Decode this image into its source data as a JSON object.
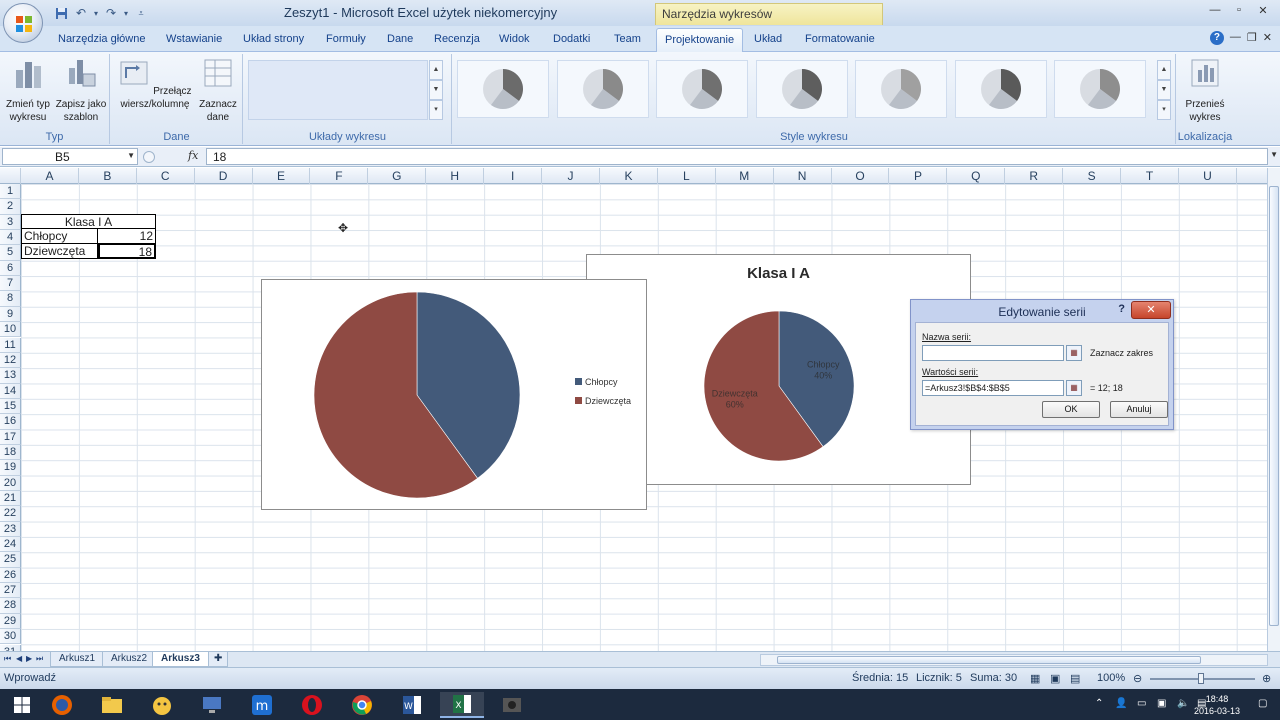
{
  "window": {
    "title": "Zeszyt1 - Microsoft Excel użytek niekomercyjny",
    "context_tab": "Narzędzia wykresów"
  },
  "ribbon": {
    "tabs": [
      "Narzędzia główne",
      "Wstawianie",
      "Układ strony",
      "Formuły",
      "Dane",
      "Recenzja",
      "Widok",
      "Dodatki",
      "Team",
      "Projektowanie",
      "Układ",
      "Formatowanie"
    ],
    "active_tab": "Projektowanie",
    "groups": {
      "typ": {
        "label": "Typ",
        "buttons": [
          "Zmień typ wykresu",
          "Zapisz jako szablon"
        ]
      },
      "dane": {
        "label": "Dane",
        "buttons": [
          "Przełącz wiersz/kolumnę",
          "Zaznacz dane"
        ]
      },
      "uklady": {
        "label": "Układy wykresu"
      },
      "style": {
        "label": "Style wykresu"
      },
      "lokalizacja": {
        "label": "Lokalizacja",
        "buttons": [
          "Przenieś wykres"
        ]
      }
    },
    "style_colors": [
      "#6b6b6b",
      "#8a8a8a",
      "#707070",
      "#5e5e5e",
      "#a0a0a0",
      "#5a5a5a",
      "#8e8e8e"
    ]
  },
  "formula_bar": {
    "name_box": "B5",
    "fx": "fx",
    "value": "18"
  },
  "grid": {
    "columns": [
      "A",
      "B",
      "C",
      "D",
      "E",
      "F",
      "G",
      "H",
      "I",
      "J",
      "K",
      "L",
      "M",
      "N",
      "O",
      "P",
      "Q",
      "R",
      "S",
      "T",
      "U"
    ],
    "rows": [
      "1",
      "2",
      "3",
      "4",
      "5",
      "6",
      "7",
      "8",
      "9",
      "10",
      "11",
      "12",
      "13",
      "14",
      "15",
      "16",
      "17",
      "18",
      "19",
      "20",
      "21",
      "22",
      "23",
      "24",
      "25",
      "26",
      "27",
      "28",
      "29",
      "30",
      "31"
    ],
    "table": {
      "header": "Klasa I A",
      "rows": [
        {
          "label": "Chłopcy",
          "value": "12"
        },
        {
          "label": "Dziewczęta",
          "value": "18"
        }
      ]
    }
  },
  "chart_data": [
    {
      "type": "pie",
      "categories": [
        "Chłopcy",
        "Dziewczęta"
      ],
      "values": [
        12,
        18
      ],
      "colors": [
        "#435a7a",
        "#8f4a43"
      ],
      "legend": "right"
    },
    {
      "type": "pie",
      "title": "Klasa I A",
      "categories": [
        "Chłopcy",
        "Dziewczęta"
      ],
      "values": [
        12,
        18
      ],
      "data_labels": [
        "40%",
        "60%"
      ],
      "colors": [
        "#435a7a",
        "#8f4a43"
      ]
    }
  ],
  "dialog": {
    "title": "Edytowanie serii",
    "help": "?",
    "close": "✕",
    "name_label": "Nazwa serii:",
    "name_value": "",
    "name_note": "Zaznacz zakres",
    "values_label": "Wartości serii:",
    "values_value": "=Arkusz3!$B$4:$B$5",
    "values_note": "= 12; 18",
    "ok": "OK",
    "cancel": "Anuluj"
  },
  "sheets": {
    "tabs": [
      "Arkusz1",
      "Arkusz2",
      "Arkusz3"
    ],
    "active": "Arkusz3"
  },
  "status": {
    "mode": "Wprowadź",
    "average": "Średnia: 15",
    "count": "Licznik: 5",
    "sum": "Suma: 30",
    "zoom": "100%"
  },
  "taskbar": {
    "time": "18:48",
    "date": "2016-03-13",
    "colors": {
      "background": "#1c2a3e"
    }
  }
}
